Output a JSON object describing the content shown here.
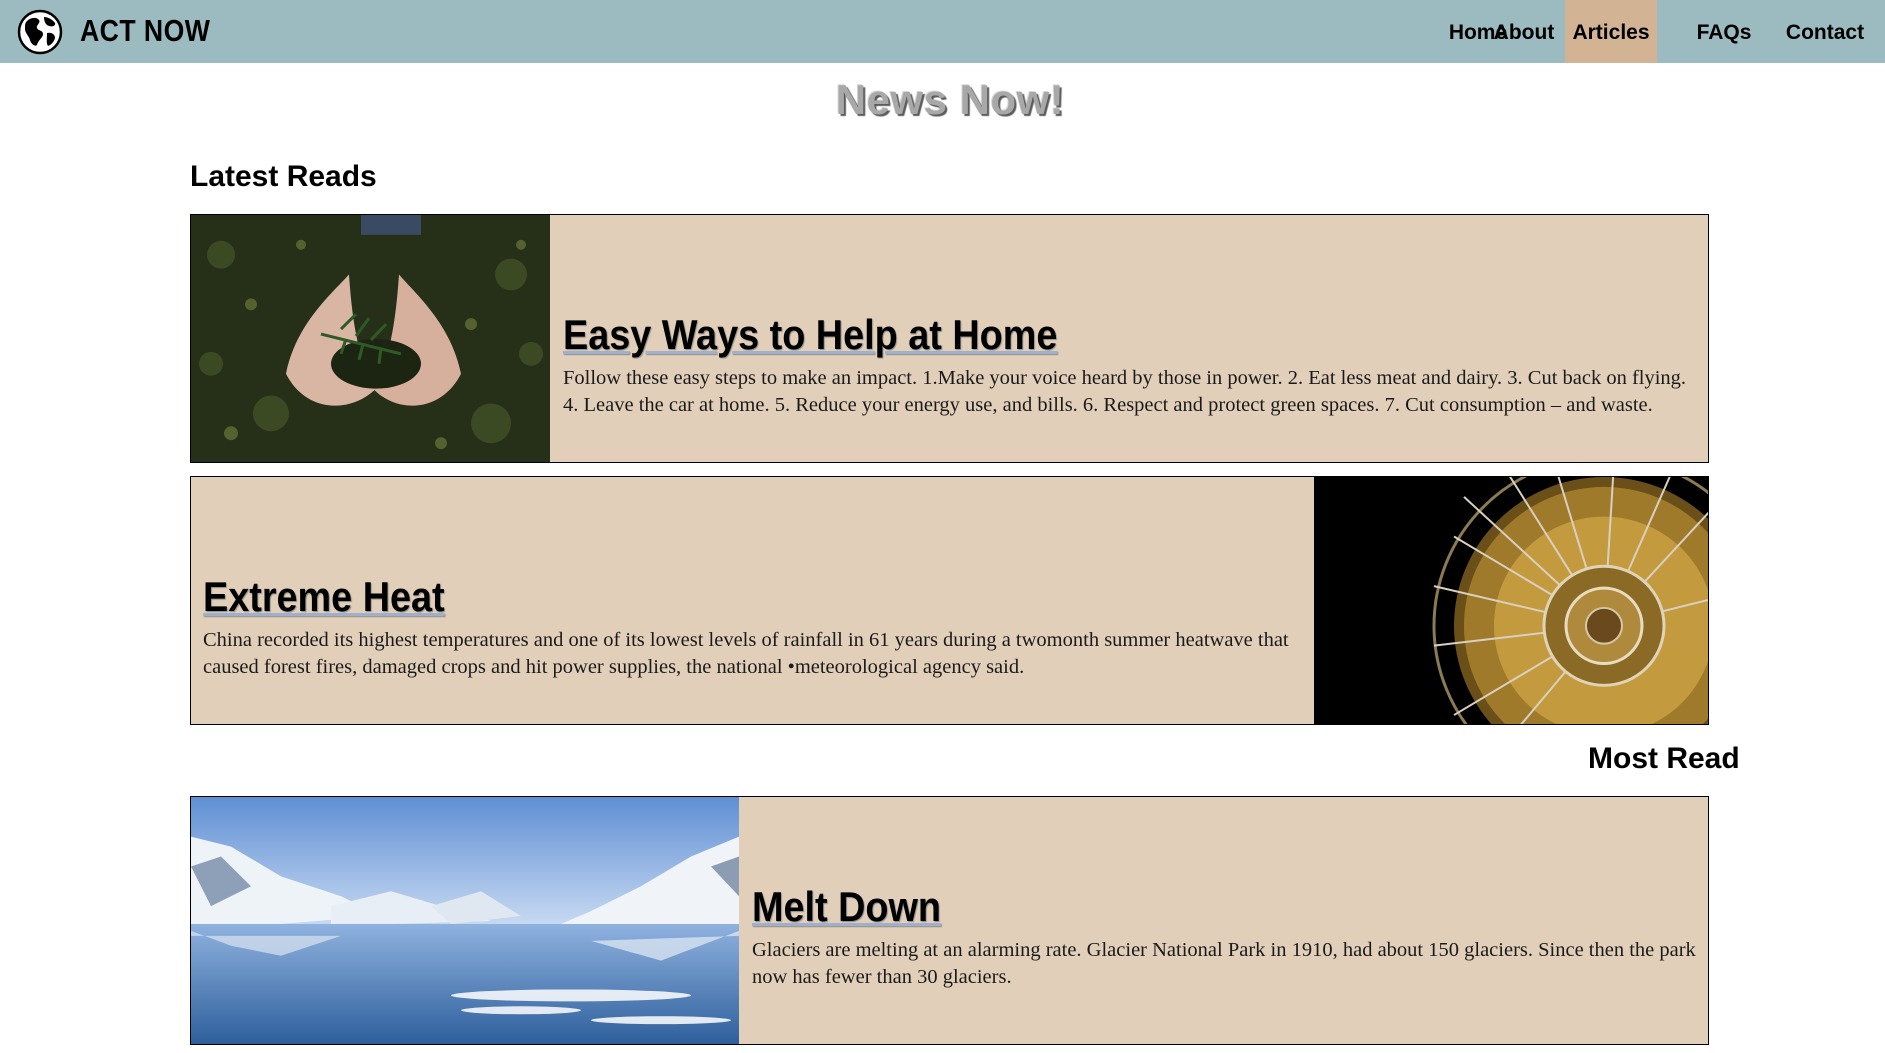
{
  "brand": {
    "name": "ACT NOW",
    "logo_icon": "globe-icon"
  },
  "nav": {
    "items": [
      {
        "label": "Home",
        "active": false
      },
      {
        "label": "About",
        "active": false
      },
      {
        "label": "Articles",
        "active": true
      },
      {
        "label": "FAQs",
        "active": false
      },
      {
        "label": "Contact",
        "active": false
      }
    ]
  },
  "page": {
    "title": "News Now!"
  },
  "sections": {
    "latest": "Latest Reads",
    "most": "Most Read"
  },
  "articles": [
    {
      "title": "Easy Ways to Help at Home",
      "body": "Follow these easy steps to make an impact. 1.Make your voice heard by those in power. 2. Eat less meat and dairy. 3. Cut back on flying. 4. Leave the car at home. 5. Reduce your energy use, and bills. 6. Respect and protect green spaces. 7. Cut consumption – and waste.",
      "image": "hands-holding-seedling-image"
    },
    {
      "title": "Extreme Heat",
      "body": "China recorded its highest temperatures and one of its lowest levels of rainfall in 61 years during a twomonth summer heatwave that caused forest fires, damaged crops and hit power supplies, the national •meteorological agency said.",
      "image": "electric-fan-image"
    },
    {
      "title": "Melt Down",
      "body": "Glaciers are melting at an alarming rate. Glacier National Park in 1910, had about 150 glaciers. Since then the park now has fewer than 30 glaciers.",
      "image": "glacier-lake-image"
    }
  ],
  "colors": {
    "navbar": "#9bbbc0",
    "active_nav": "#d2b495",
    "card_bg": "#e2cfba"
  }
}
